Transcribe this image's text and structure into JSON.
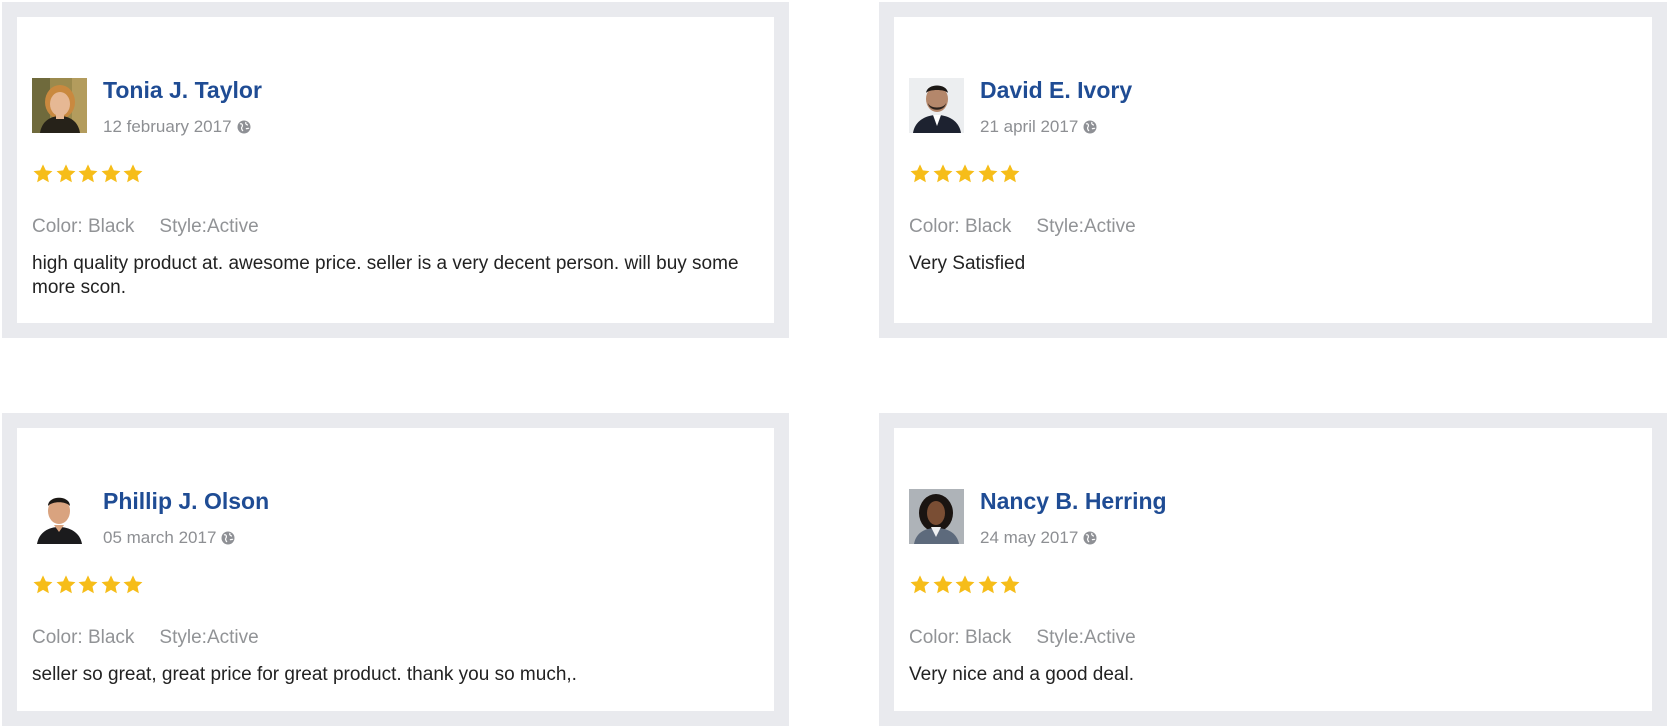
{
  "colors": {
    "name": "#1f4c94",
    "star": "#f6bd19",
    "card_border": "#e9eaee",
    "muted_text": "#8d8f93",
    "body_text": "#222222"
  },
  "reviews": [
    {
      "name": "Tonia J. Taylor",
      "date": "12 february 2017",
      "rating": 5,
      "color": "Color: Black",
      "style": "Style:Active",
      "text": "high quality product at. awesome price. seller is a very decent person. will buy some more scon."
    },
    {
      "name": "David E. Ivory",
      "date": "21 april 2017",
      "rating": 5,
      "color": "Color: Black",
      "style": "Style:Active",
      "text": "Very Satisfied"
    },
    {
      "name": "Phillip J. Olson",
      "date": "05 march 2017",
      "rating": 5,
      "color": "Color: Black",
      "style": "Style:Active",
      "text": "seller so great, great price for great product. thank you so much,."
    },
    {
      "name": "Nancy B. Herring",
      "date": "24 may 2017",
      "rating": 5,
      "color": "Color: Black",
      "style": "Style:Active",
      "text": "Very nice and a good deal."
    }
  ]
}
